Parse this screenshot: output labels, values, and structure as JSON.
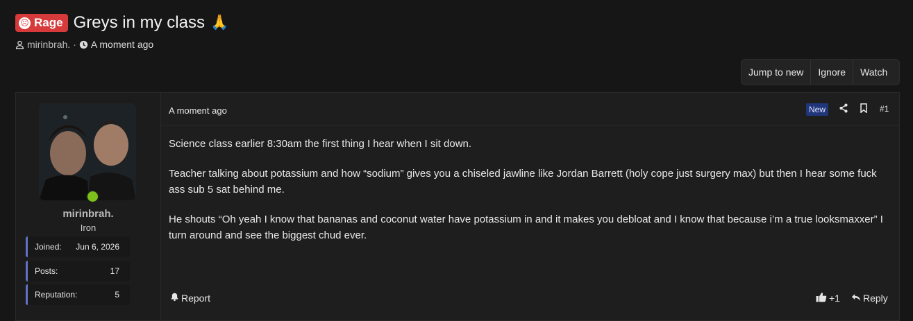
{
  "thread": {
    "prefix": "Rage",
    "title": "Greys in my class",
    "title_emoji": "🙏",
    "author": "mirinbrah.",
    "separator": "·",
    "time": "A moment ago"
  },
  "actions": [
    "Jump to new",
    "Ignore",
    "Watch"
  ],
  "post": {
    "user": {
      "name": "mirinbrah.",
      "title": "Iron",
      "online": true,
      "stats": [
        {
          "label": "Joined:",
          "value": "Jun 6, 2026"
        },
        {
          "label": "Posts:",
          "value": "17"
        },
        {
          "label": "Reputation:",
          "value": "5"
        }
      ]
    },
    "date": "A moment ago",
    "badge": "New",
    "number": "#1",
    "paragraphs": [
      "Science class earlier 8:30am the first thing I hear when I sit down.",
      "Teacher talking about potassium and how “sodium” gives you a chiseled jawline like Jordan Barrett (holy cope just surgery max) but then I hear some fuck ass sub 5 sat behind me.",
      "He shouts “Oh yeah I know that bananas and coconut water have potassium in and it makes you debloat and I know that because i’m a true looksmaxxer” I turn around and see the biggest chud ever."
    ],
    "report_label": "Report",
    "reaction_count": "+1",
    "reply_label": "Reply"
  },
  "colors": {
    "background": "#161616",
    "prefix_red": "#d63a3a",
    "online_green": "#7bc11a",
    "stat_accent": "#5f73c9",
    "new_badge": "#20367a"
  }
}
